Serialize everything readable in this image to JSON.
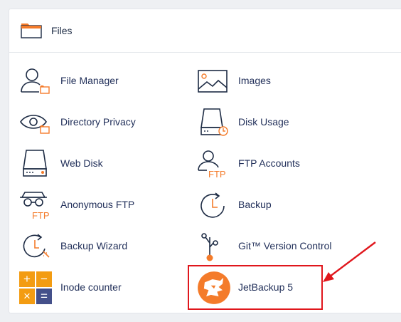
{
  "section": {
    "title": "Files",
    "icon": "folder-icon"
  },
  "colors": {
    "accent_orange": "#f47b2a",
    "icon_dark": "#1d2b44",
    "highlight_red": "#e0161c",
    "inode_orange": "#f39c12",
    "inode_navy": "#44508a"
  },
  "items": {
    "file_manager": {
      "label": "File Manager",
      "icon": "file-manager-icon"
    },
    "images": {
      "label": "Images",
      "icon": "images-icon"
    },
    "directory_privacy": {
      "label": "Directory Privacy",
      "icon": "directory-privacy-icon"
    },
    "disk_usage": {
      "label": "Disk Usage",
      "icon": "disk-usage-icon"
    },
    "web_disk": {
      "label": "Web Disk",
      "icon": "web-disk-icon"
    },
    "ftp_accounts": {
      "label": "FTP Accounts",
      "icon": "ftp-accounts-icon"
    },
    "anonymous_ftp": {
      "label": "Anonymous FTP",
      "icon": "anonymous-ftp-icon"
    },
    "backup": {
      "label": "Backup",
      "icon": "backup-icon"
    },
    "backup_wizard": {
      "label": "Backup Wizard",
      "icon": "backup-wizard-icon"
    },
    "git": {
      "label": "Git™ Version Control",
      "icon": "git-icon"
    },
    "inode_counter": {
      "label": "Inode counter",
      "icon": "inode-counter-icon",
      "symbols": [
        "+",
        "−",
        "×",
        "="
      ]
    },
    "jetbackup": {
      "label": "JetBackup 5",
      "icon": "jetbackup-icon"
    }
  },
  "ftp_text": "FTP"
}
